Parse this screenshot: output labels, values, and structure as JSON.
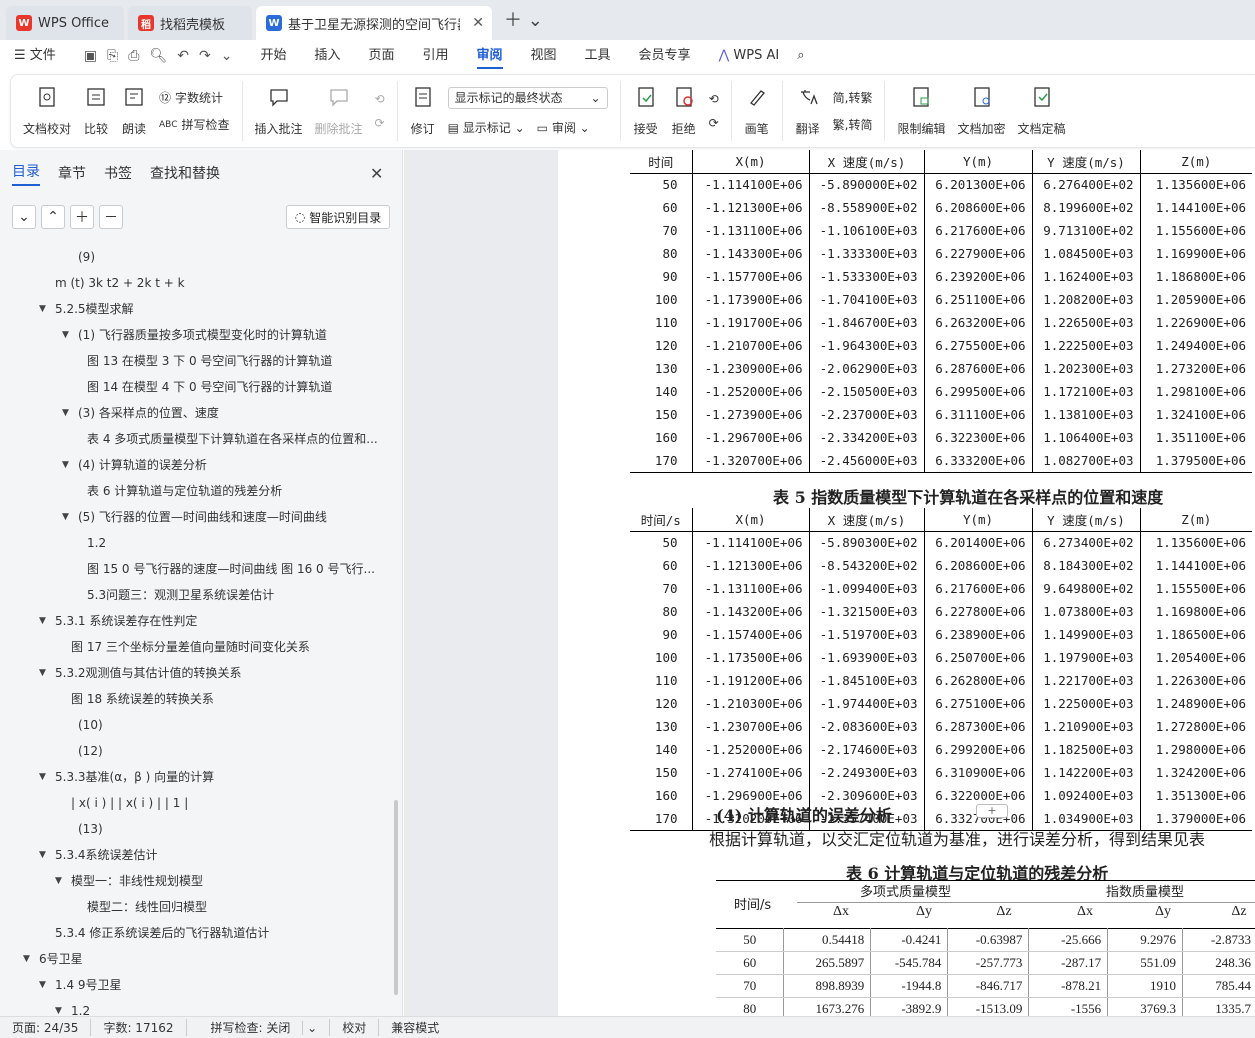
{
  "tabs": [
    {
      "label": "WPS Office",
      "icon": "wps-logo-icon"
    },
    {
      "label": "找稻壳模板",
      "icon": "docer-logo-icon"
    },
    {
      "label": "基于卫星无源探测的空间飞行器",
      "icon": "word-doc-icon"
    }
  ],
  "menu": {
    "file": "文件",
    "items": [
      "开始",
      "插入",
      "页面",
      "引用",
      "审阅",
      "视图",
      "工具",
      "会员专享"
    ],
    "active": "审阅",
    "ai": "WPS AI"
  },
  "ribbon": {
    "doc_check": "文档校对",
    "compare": "比较",
    "read_aloud": "朗读",
    "word_count": "字数统计",
    "spell_check": "拼写检查",
    "insert_comment": "插入批注",
    "delete_comment": "删除批注",
    "revise": "修订",
    "markup_select": "显示标记的最终状态",
    "show_markup": "显示标记",
    "review": "审阅",
    "accept": "接受",
    "reject": "拒绝",
    "pen": "画笔",
    "translate": "翻译",
    "trad_to_simp": "简,转繁",
    "simp_to_trad": "繁,转简",
    "restrict_edit": "限制编辑",
    "doc_encrypt": "文档加密",
    "doc_finalize": "文档定稿"
  },
  "nav": {
    "tabs": [
      "目录",
      "章节",
      "书签",
      "查找和替换"
    ],
    "smart_toc": "智能识别目录",
    "items": [
      {
        "text": "(9)",
        "indent": 78,
        "tri": ""
      },
      {
        "text": "m (t)  3k t2 + 2k t + k",
        "indent": 55,
        "tri": ""
      },
      {
        "text": "5.2.5模型求解",
        "indent": 55,
        "tri": "▼"
      },
      {
        "text": "(1) 飞行器质量按多项式模型变化时的计算轨道",
        "indent": 78,
        "tri": "▼"
      },
      {
        "text": "图 13 在模型 3 下 0 号空间飞行器的计算轨道",
        "indent": 87,
        "tri": ""
      },
      {
        "text": "图 14 在模型 4 下 0 号空间飞行器的计算轨道",
        "indent": 87,
        "tri": ""
      },
      {
        "text": "(3) 各采样点的位置、速度",
        "indent": 78,
        "tri": "▼"
      },
      {
        "text": "表 4 多项式质量模型下计算轨道在各采样点的位置和...",
        "indent": 87,
        "tri": ""
      },
      {
        "text": "(4) 计算轨道的误差分析",
        "indent": 78,
        "tri": "▼"
      },
      {
        "text": "表 6 计算轨道与定位轨道的残差分析",
        "indent": 87,
        "tri": ""
      },
      {
        "text": "(5) 飞行器的位置—时间曲线和速度—时间曲线",
        "indent": 78,
        "tri": "▼"
      },
      {
        "text": "1.2",
        "indent": 87,
        "tri": ""
      },
      {
        "text": "图 15 0 号飞行器的速度—时间曲线 图 16 0 号飞行...",
        "indent": 87,
        "tri": ""
      },
      {
        "text": "5.3问题三：观测卫星系统误差估计",
        "indent": 87,
        "tri": ""
      },
      {
        "text": "5.3.1 系统误差存在性判定",
        "indent": 55,
        "tri": "▼"
      },
      {
        "text": "图 17 三个坐标分量差值向量随时间变化关系",
        "indent": 71,
        "tri": ""
      },
      {
        "text": "5.3.2观测值与其估计值的转换关系",
        "indent": 55,
        "tri": "▼"
      },
      {
        "text": "图 18 系统误差的转换关系",
        "indent": 71,
        "tri": ""
      },
      {
        "text": "(10)",
        "indent": 78,
        "tri": ""
      },
      {
        "text": "(12)",
        "indent": 78,
        "tri": ""
      },
      {
        "text": "5.3.3基准(α，β ) 向量的计算",
        "indent": 55,
        "tri": "▼"
      },
      {
        "text": "|   x( i ) |   |   x( i ) |   |  1 |",
        "indent": 71,
        "tri": ""
      },
      {
        "text": "(13)",
        "indent": 78,
        "tri": ""
      },
      {
        "text": "5.3.4系统误差估计",
        "indent": 55,
        "tri": "▼"
      },
      {
        "text": "模型一：非线性规划模型",
        "indent": 71,
        "tri": "▼"
      },
      {
        "text": "模型二：线性回归模型",
        "indent": 87,
        "tri": ""
      },
      {
        "text": "5.3.4 修正系统误差后的飞行器轨道估计",
        "indent": 55,
        "tri": ""
      },
      {
        "text": "6号卫星",
        "indent": 39,
        "tri": "▼"
      },
      {
        "text": "1.4 9号卫星",
        "indent": 55,
        "tri": "▼"
      },
      {
        "text": "1.2",
        "indent": 71,
        "tri": "▼"
      }
    ]
  },
  "table4": {
    "headers": [
      "时间",
      "X(m)",
      "X 速度(m/s)",
      "Y(m)",
      "Y 速度(m/s)",
      "Z(m)"
    ],
    "rows": [
      [
        "50",
        "-1.114100E+06",
        "-5.890000E+02",
        "6.201300E+06",
        "6.276400E+02",
        "1.135600E+06"
      ],
      [
        "60",
        "-1.121300E+06",
        "-8.558900E+02",
        "6.208600E+06",
        "8.199600E+02",
        "1.144100E+06"
      ],
      [
        "70",
        "-1.131100E+06",
        "-1.106100E+03",
        "6.217600E+06",
        "9.713100E+02",
        "1.155600E+06"
      ],
      [
        "80",
        "-1.143300E+06",
        "-1.333300E+03",
        "6.227900E+06",
        "1.084500E+03",
        "1.169900E+06"
      ],
      [
        "90",
        "-1.157700E+06",
        "-1.533300E+03",
        "6.239200E+06",
        "1.162400E+03",
        "1.186800E+06"
      ],
      [
        "100",
        "-1.173900E+06",
        "-1.704100E+03",
        "6.251100E+06",
        "1.208200E+03",
        "1.205900E+06"
      ],
      [
        "110",
        "-1.191700E+06",
        "-1.846700E+03",
        "6.263200E+06",
        "1.226500E+03",
        "1.226900E+06"
      ],
      [
        "120",
        "-1.210700E+06",
        "-1.964300E+03",
        "6.275500E+06",
        "1.222500E+03",
        "1.249400E+06"
      ],
      [
        "130",
        "-1.230900E+06",
        "-2.062900E+03",
        "6.287600E+06",
        "1.202300E+03",
        "1.273200E+06"
      ],
      [
        "140",
        "-1.252000E+06",
        "-2.150500E+03",
        "6.299500E+06",
        "1.172100E+03",
        "1.298100E+06"
      ],
      [
        "150",
        "-1.273900E+06",
        "-2.237000E+03",
        "6.311100E+06",
        "1.138100E+03",
        "1.324100E+06"
      ],
      [
        "160",
        "-1.296700E+06",
        "-2.334200E+03",
        "6.322300E+06",
        "1.106400E+03",
        "1.351100E+06"
      ],
      [
        "170",
        "-1.320700E+06",
        "-2.456000E+03",
        "6.333200E+06",
        "1.082700E+03",
        "1.379500E+06"
      ]
    ]
  },
  "table5": {
    "caption": "表 5  指数质量模型下计算轨道在各采样点的位置和速度",
    "headers": [
      "时间/s",
      "X(m)",
      "X 速度(m/s)",
      "Y(m)",
      "Y 速度(m/s)",
      "Z(m)"
    ],
    "rows": [
      [
        "50",
        "-1.114100E+06",
        "-5.890300E+02",
        "6.201400E+06",
        "6.273400E+02",
        "1.135600E+06"
      ],
      [
        "60",
        "-1.121300E+06",
        "-8.543200E+02",
        "6.208600E+06",
        "8.184300E+02",
        "1.144100E+06"
      ],
      [
        "70",
        "-1.131100E+06",
        "-1.099400E+03",
        "6.217600E+06",
        "9.649800E+02",
        "1.155500E+06"
      ],
      [
        "80",
        "-1.143200E+06",
        "-1.321500E+03",
        "6.227800E+06",
        "1.073800E+03",
        "1.169800E+06"
      ],
      [
        "90",
        "-1.157400E+06",
        "-1.519700E+03",
        "6.238900E+06",
        "1.149900E+03",
        "1.186500E+06"
      ],
      [
        "100",
        "-1.173500E+06",
        "-1.693900E+03",
        "6.250700E+06",
        "1.197900E+03",
        "1.205400E+06"
      ],
      [
        "110",
        "-1.191200E+06",
        "-1.845100E+03",
        "6.262800E+06",
        "1.221700E+03",
        "1.226300E+06"
      ],
      [
        "120",
        "-1.210300E+06",
        "-1.974400E+03",
        "6.275100E+06",
        "1.225000E+03",
        "1.248900E+06"
      ],
      [
        "130",
        "-1.230700E+06",
        "-2.083600E+03",
        "6.287300E+06",
        "1.210900E+03",
        "1.272800E+06"
      ],
      [
        "140",
        "-1.252000E+06",
        "-2.174600E+03",
        "6.299200E+06",
        "1.182500E+03",
        "1.298000E+06"
      ],
      [
        "150",
        "-1.274100E+06",
        "-2.249300E+03",
        "6.310900E+06",
        "1.142200E+03",
        "1.324200E+06"
      ],
      [
        "160",
        "-1.296900E+06",
        "-2.309600E+03",
        "6.322000E+06",
        "1.092400E+03",
        "1.351300E+06"
      ],
      [
        "170",
        "-1.320200E+06",
        "-2.357400E+03",
        "6.332700E+06",
        "1.034900E+03",
        "1.379000E+06"
      ]
    ]
  },
  "section4": {
    "heading": "(4) 计算轨道的误差分析",
    "para": "根据计算轨道，以交汇定位轨道为基准，进行误差分析，得到结果见表"
  },
  "table6": {
    "caption": "表 6  计算轨道与定位轨道的残差分析",
    "time_label": "时间/s",
    "group1": "多项式质量模型",
    "group2": "指数质量模型",
    "sub": [
      "Δx",
      "Δy",
      "Δz",
      "Δx",
      "Δy",
      "Δz"
    ],
    "rows": [
      [
        "50",
        "0.54418",
        "-0.4241",
        "-0.63987",
        "-25.666",
        "9.2976",
        "-2.8733"
      ],
      [
        "60",
        "265.5897",
        "-545.784",
        "-257.773",
        "-287.17",
        "551.09",
        "248.36"
      ],
      [
        "70",
        "898.8939",
        "-1944.8",
        "-846.717",
        "-878.21",
        "1910",
        "785.44"
      ],
      [
        "80",
        "1673.276",
        "-3892.9",
        "-1513.09",
        "-1556",
        "3769.3",
        "1335.7"
      ]
    ]
  },
  "status": {
    "page": "页面: 24/35",
    "words": "字数: 17162",
    "spell": "拼写检查: 关闭",
    "proof": "校对",
    "compat": "兼容模式"
  }
}
